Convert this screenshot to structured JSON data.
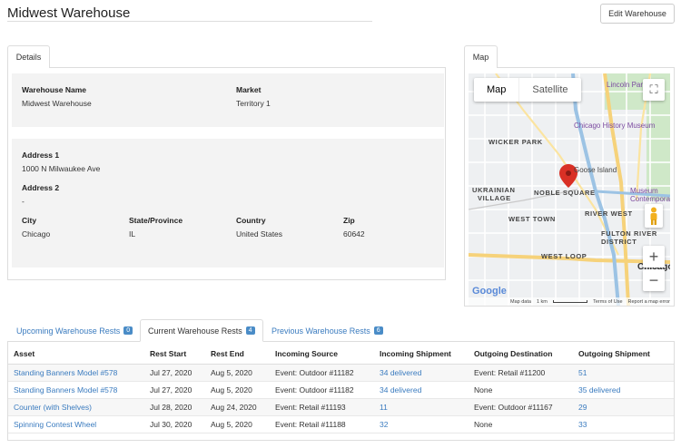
{
  "header": {
    "title": "Midwest Warehouse",
    "edit_label": "Edit Warehouse"
  },
  "details": {
    "tab_label": "Details",
    "warehouse_name_label": "Warehouse Name",
    "warehouse_name": "Midwest Warehouse",
    "market_label": "Market",
    "market": "Territory 1",
    "address1_label": "Address 1",
    "address1": "1000 N Milwaukee Ave",
    "address2_label": "Address 2",
    "address2": "-",
    "city_label": "City",
    "city": "Chicago",
    "state_label": "State/Province",
    "state": "IL",
    "country_label": "Country",
    "country": "United States",
    "zip_label": "Zip",
    "zip": "60642"
  },
  "map": {
    "tab_label": "Map",
    "map_button": "Map",
    "satellite_button": "Satellite",
    "labels": {
      "lincoln_park": "Lincoln Park",
      "chicago_history_museum": "Chicago History Museum",
      "wicker_park": "WICKER PARK",
      "goose_island": "Goose Island",
      "ukrainian_village_1": "UKRAINIAN",
      "ukrainian_village_2": "VILLAGE",
      "noble_square": "NOBLE SQUARE",
      "museum_contemporary_1": "Museum",
      "museum_contemporary_2": "Contemporar",
      "west_town": "WEST TOWN",
      "river_west": "RIVER WEST",
      "fulton_river_1": "FULTON RIVER",
      "fulton_river_2": "DISTRICT",
      "west_loop": "WEST LOOP",
      "chicago": "Chicago"
    },
    "google_logo": "Google",
    "footer": {
      "map_data": "Map data",
      "scale": "1 km",
      "terms": "Terms of Use",
      "report": "Report a map error"
    },
    "accent_pin": "#d93025"
  },
  "rests_tabs": [
    {
      "label": "Upcoming Warehouse Rests",
      "count": "0"
    },
    {
      "label": "Current Warehouse Rests",
      "count": "4"
    },
    {
      "label": "Previous Warehouse Rests",
      "count": "6"
    }
  ],
  "table": {
    "headers": [
      "Asset",
      "Rest Start",
      "Rest End",
      "Incoming Source",
      "Incoming Shipment",
      "Outgoing Destination",
      "Outgoing Shipment"
    ],
    "rows": [
      [
        "Standing Banners Model #578",
        "Jul 27, 2020",
        "Aug 5, 2020",
        "Event: Outdoor #11182",
        "34 delivered",
        "Event: Retail #11200",
        "51"
      ],
      [
        "Standing Banners Model #578",
        "Jul 27, 2020",
        "Aug 5, 2020",
        "Event: Outdoor #11182",
        "34 delivered",
        "None",
        "35 delivered"
      ],
      [
        "Counter (with Shelves)",
        "Jul 28, 2020",
        "Aug 24, 2020",
        "Event: Retail #11193",
        "11",
        "Event: Outdoor #11167",
        "29"
      ],
      [
        "Spinning Contest Wheel",
        "Jul 30, 2020",
        "Aug 5, 2020",
        "Event: Retail #11188",
        "32",
        "None",
        "33"
      ]
    ]
  },
  "colors": {
    "link": "#3a7bbf",
    "badge": "#4a8cc7"
  }
}
